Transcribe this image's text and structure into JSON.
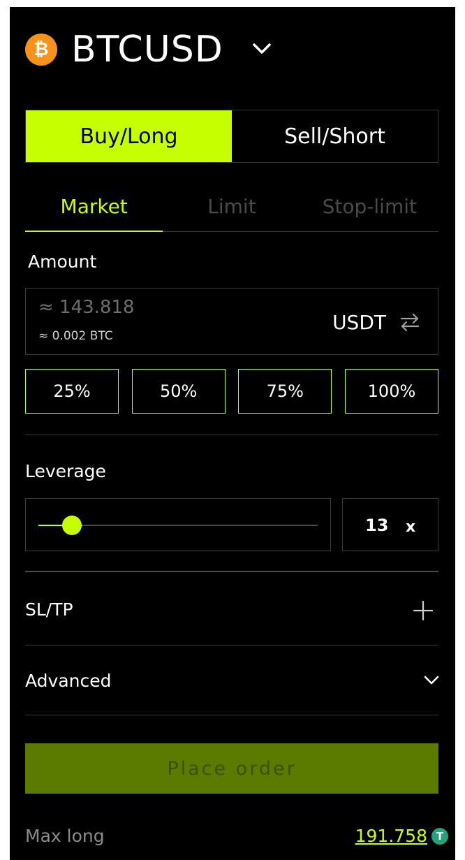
{
  "header": {
    "symbol": "BTCUSD",
    "coin_icon": "bitcoin-icon",
    "coin_icon_glyph": "₿"
  },
  "side_toggle": {
    "buy_label": "Buy/Long",
    "sell_label": "Sell/Short",
    "selected": "buy"
  },
  "order_tabs": [
    {
      "label": "Market",
      "active": true
    },
    {
      "label": "Limit",
      "active": false
    },
    {
      "label": "Stop-limit",
      "active": false
    }
  ],
  "amount": {
    "label": "Amount",
    "value": "≈ 143.818",
    "btc_equivalent": "≈ 0.002 BTC",
    "currency": "USDT"
  },
  "percent_buttons": [
    "25%",
    "50%",
    "75%",
    "100%"
  ],
  "leverage": {
    "label": "Leverage",
    "value": "13",
    "unit": "x",
    "slider_fraction": 0.12
  },
  "sl_tp": {
    "label": "SL/TP"
  },
  "advanced": {
    "label": "Advanced"
  },
  "place_order": {
    "label": "Place order"
  },
  "max_long": {
    "label": "Max long",
    "value": "191.758",
    "currency_icon_glyph": "T"
  },
  "colors": {
    "accent": "#c6ff00",
    "background": "#000000",
    "border": "#3a3a3a",
    "place_order_bg": "#5a7a00",
    "bitcoin": "#f7931a",
    "usdt": "#26a17b"
  }
}
